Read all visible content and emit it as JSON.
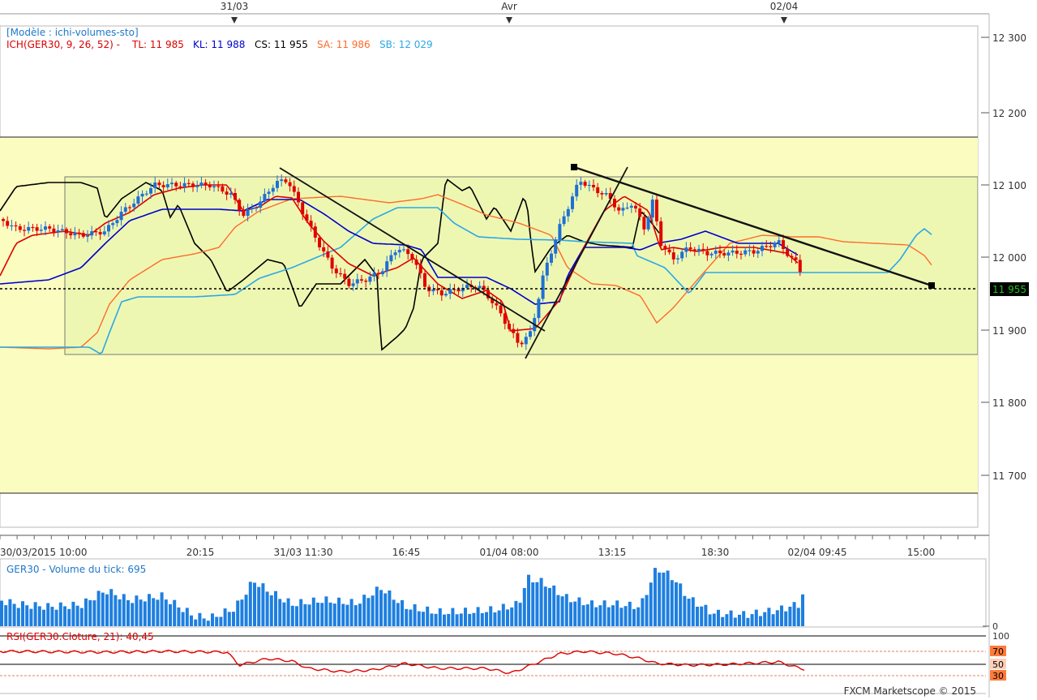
{
  "top_axis": {
    "labels": [
      {
        "text": "31/03",
        "marker": true
      },
      {
        "text": "Avr",
        "marker": true
      },
      {
        "text": "02/04",
        "marker": true
      }
    ]
  },
  "legend": {
    "model": "[Modèle : ichi-volumes-sto]",
    "ichimoku": "ICH(GER30, 9, 26, 52) -",
    "tl": "TL: 11 985",
    "kl": "KL: 11 988",
    "cs": "CS: 11 955",
    "sa": "SA: 11 986",
    "sb": "SB: 12 029"
  },
  "price_axis": {
    "ticks": [
      "12 300",
      "12 200",
      "12 100",
      "12 000",
      "11 900",
      "11 800",
      "11 700"
    ],
    "current_value": "11 955"
  },
  "time_axis": {
    "labels": [
      "30/03/2015 10:00",
      "20:15",
      "31/03 11:30",
      "16:45",
      "01/04 08:00",
      "13:15",
      "18:30",
      "02/04 09:45",
      "15:00"
    ]
  },
  "volume_panel": {
    "title": "GER30 - Volume du tick: 695",
    "zero_label": "0"
  },
  "rsi_panel": {
    "title": "RSI(GER30.Cloture, 21): 40,45",
    "levels": [
      "100",
      "70",
      "50",
      "30"
    ]
  },
  "footer": {
    "copyright": "FXCM Marketscope © 2015"
  },
  "colors": {
    "bull": "#1e6fd6",
    "bear": "#e00000",
    "tenkan": "#dd0000",
    "kijun": "#0000cc",
    "span_a": "#ff6a2a",
    "span_b": "#2aa8e8",
    "chikou": "#000000",
    "volume": "#1e7fe0",
    "rsi": "#dd0000",
    "band_fill": "#fafcc0",
    "highlight": "#1fc21f",
    "text_blue": "#1f78c8"
  },
  "chart_data": {
    "type": "candlestick",
    "instrument": "GER30",
    "ylim": [
      11645,
      12315
    ],
    "price_series_approx": [
      {
        "x": "30/03/2015 10:00",
        "close": 12040
      },
      {
        "x": "20:15",
        "close": 12095
      },
      {
        "x": "31/03 11:30",
        "close": 12110
      },
      {
        "x": "16:45",
        "close": 11985
      },
      {
        "x": "01/04 08:00",
        "close": 11890
      },
      {
        "x": "13:15",
        "close": 12080
      },
      {
        "x": "18:30",
        "close": 12005
      },
      {
        "x": "02/04 09:45",
        "close": 11955
      }
    ],
    "last_price": 11955,
    "indicators": {
      "tenkan": 11985,
      "kijun": 11988,
      "chikou": 11955,
      "span_a": 11986,
      "span_b": 12029
    },
    "volume_last": 695,
    "rsi_last": 40.45
  }
}
